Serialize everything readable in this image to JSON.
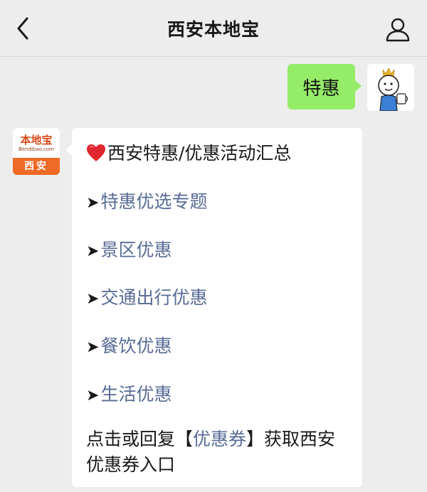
{
  "nav": {
    "title": "西安本地宝",
    "back_icon": "chevron-left-icon",
    "profile_icon": "person-icon"
  },
  "outgoing": {
    "text": "特惠"
  },
  "bot": {
    "avatar": {
      "brand": "本地宝",
      "domain": "Bendibao.com",
      "city": "西安"
    },
    "message": {
      "headline": "西安特惠/优惠活动汇总",
      "heart_icon": "heart-icon",
      "arrow": "➤",
      "items": [
        "特惠优选专题",
        "景区优惠",
        "交通出行优惠",
        "餐饮优惠",
        "生活优惠"
      ],
      "footer_prefix": "点击或回复【",
      "footer_link": "优惠券",
      "footer_suffix": "】获取西安优惠券入口"
    }
  },
  "colors": {
    "background": "#ededed",
    "outgoing_bubble": "#95ec69",
    "link": "#576b95",
    "heart": "#e0262f",
    "brand_orange": "#ee6a25"
  }
}
